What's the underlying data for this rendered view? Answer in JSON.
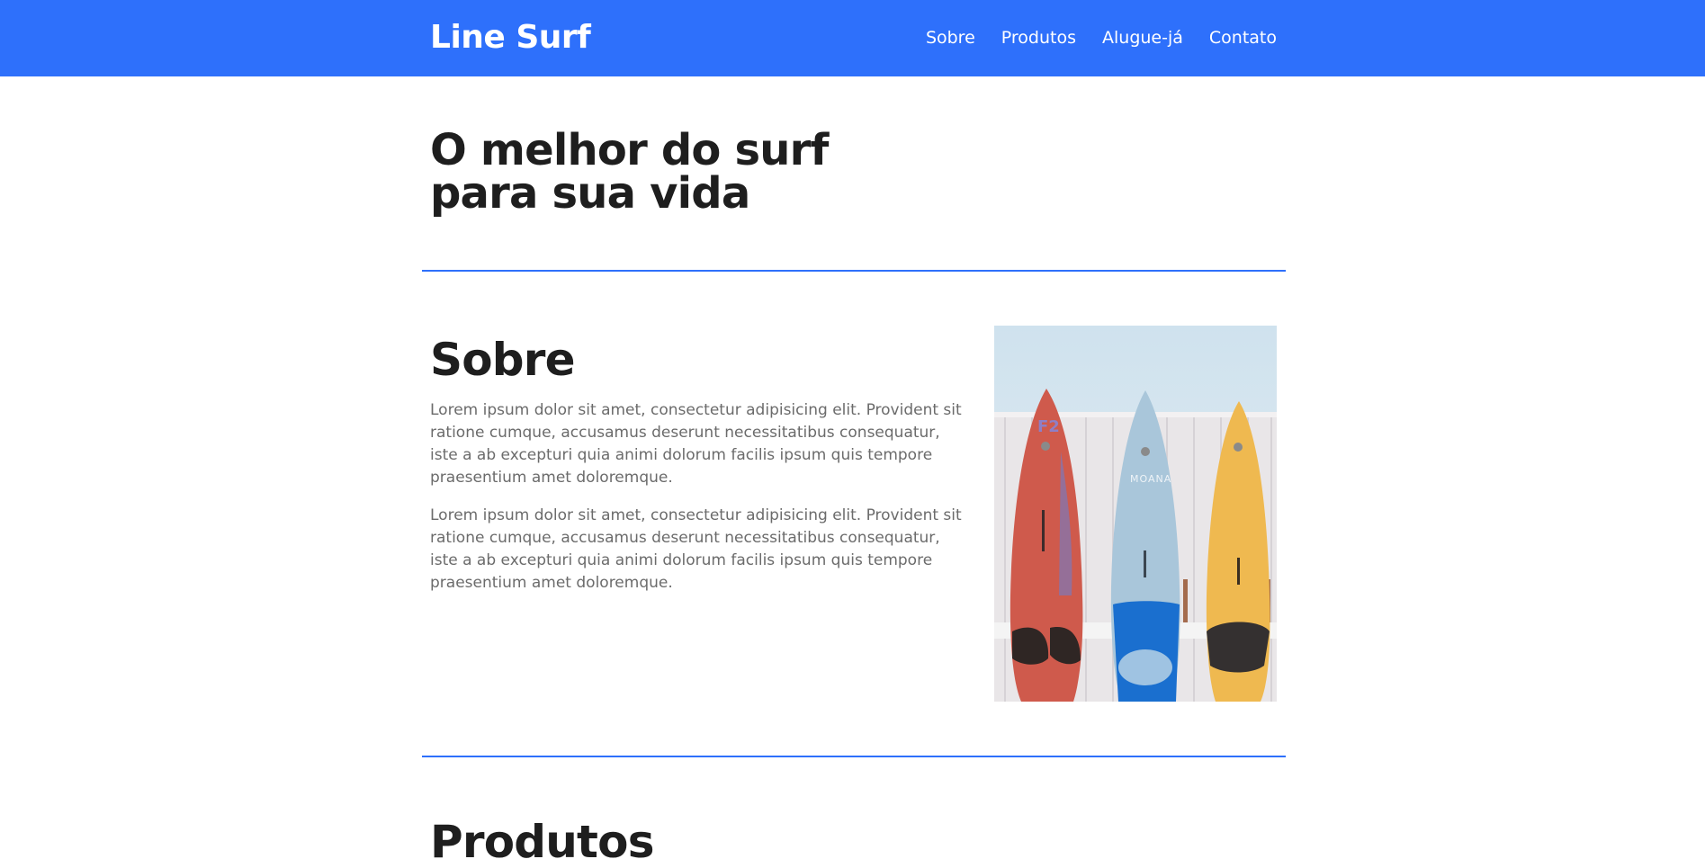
{
  "header": {
    "logo": "Line Surf",
    "nav": [
      "Sobre",
      "Produtos",
      "Alugue-já",
      "Contato"
    ]
  },
  "hero": {
    "title_line1": "O melhor do surf",
    "title_line2": "para sua vida"
  },
  "about": {
    "title": "Sobre",
    "paragraphs": [
      "Lorem ipsum dolor sit amet, consectetur adipisicing elit. Provident sit ratione cumque, accusamus deserunt necessitatibus consequatur, iste a ab excepturi quia animi dolorum facilis ipsum quis tempore praesentium amet doloremque.",
      "Lorem ipsum dolor sit amet, consectetur adipisicing elit. Provident sit ratione cumque, accusamus deserunt necessitatibus consequatur, iste a ab excepturi quia animi dolorum facilis ipsum quis tempore praesentium amet doloremque."
    ],
    "image_board_label": "MOANA"
  },
  "products": {
    "title": "Produtos"
  },
  "colors": {
    "brand": "#2e70fb",
    "heading": "#1e1e1e",
    "body_text": "#6b6b6b"
  }
}
